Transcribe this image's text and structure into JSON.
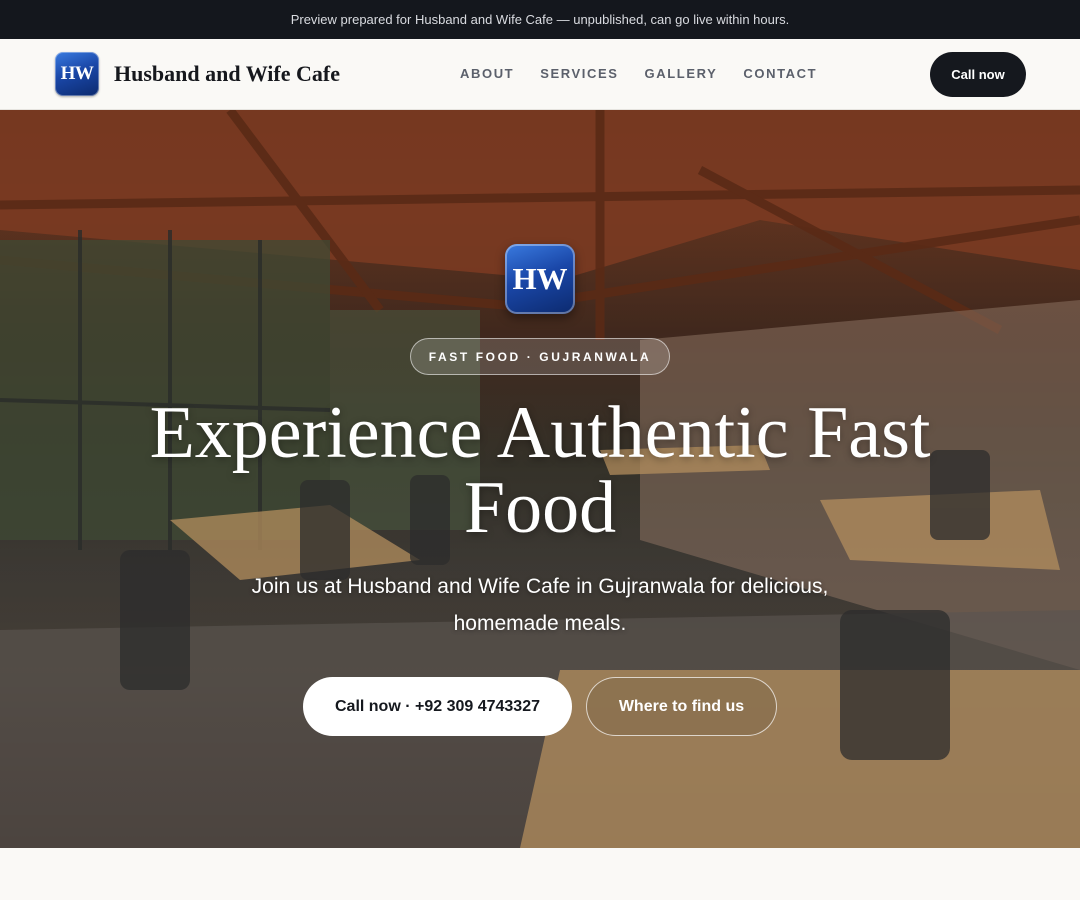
{
  "banner": {
    "text": "Preview prepared for Husband and Wife Cafe — unpublished, can go live within hours."
  },
  "header": {
    "logo_text": "HW",
    "brand_name": "Husband and Wife Cafe",
    "nav": [
      {
        "label": "ABOUT"
      },
      {
        "label": "SERVICES"
      },
      {
        "label": "GALLERY"
      },
      {
        "label": "CONTACT"
      }
    ],
    "cta_label": "Call now"
  },
  "hero": {
    "logo_text": "HW",
    "eyebrow": "FAST FOOD · GUJRANWALA",
    "headline": "Experience Authentic Fast Food",
    "subheadline": "Join us at Husband and Wife Cafe in Gujranwala for delicious, homemade meals.",
    "primary_button": "Call now · +92 309 4743327",
    "secondary_button": "Where to find us",
    "background_image": "cafe-interior-photo"
  },
  "colors": {
    "dark": "#15181e",
    "logo_blue": "#1a47a8",
    "page_bg": "#faf9f6"
  }
}
